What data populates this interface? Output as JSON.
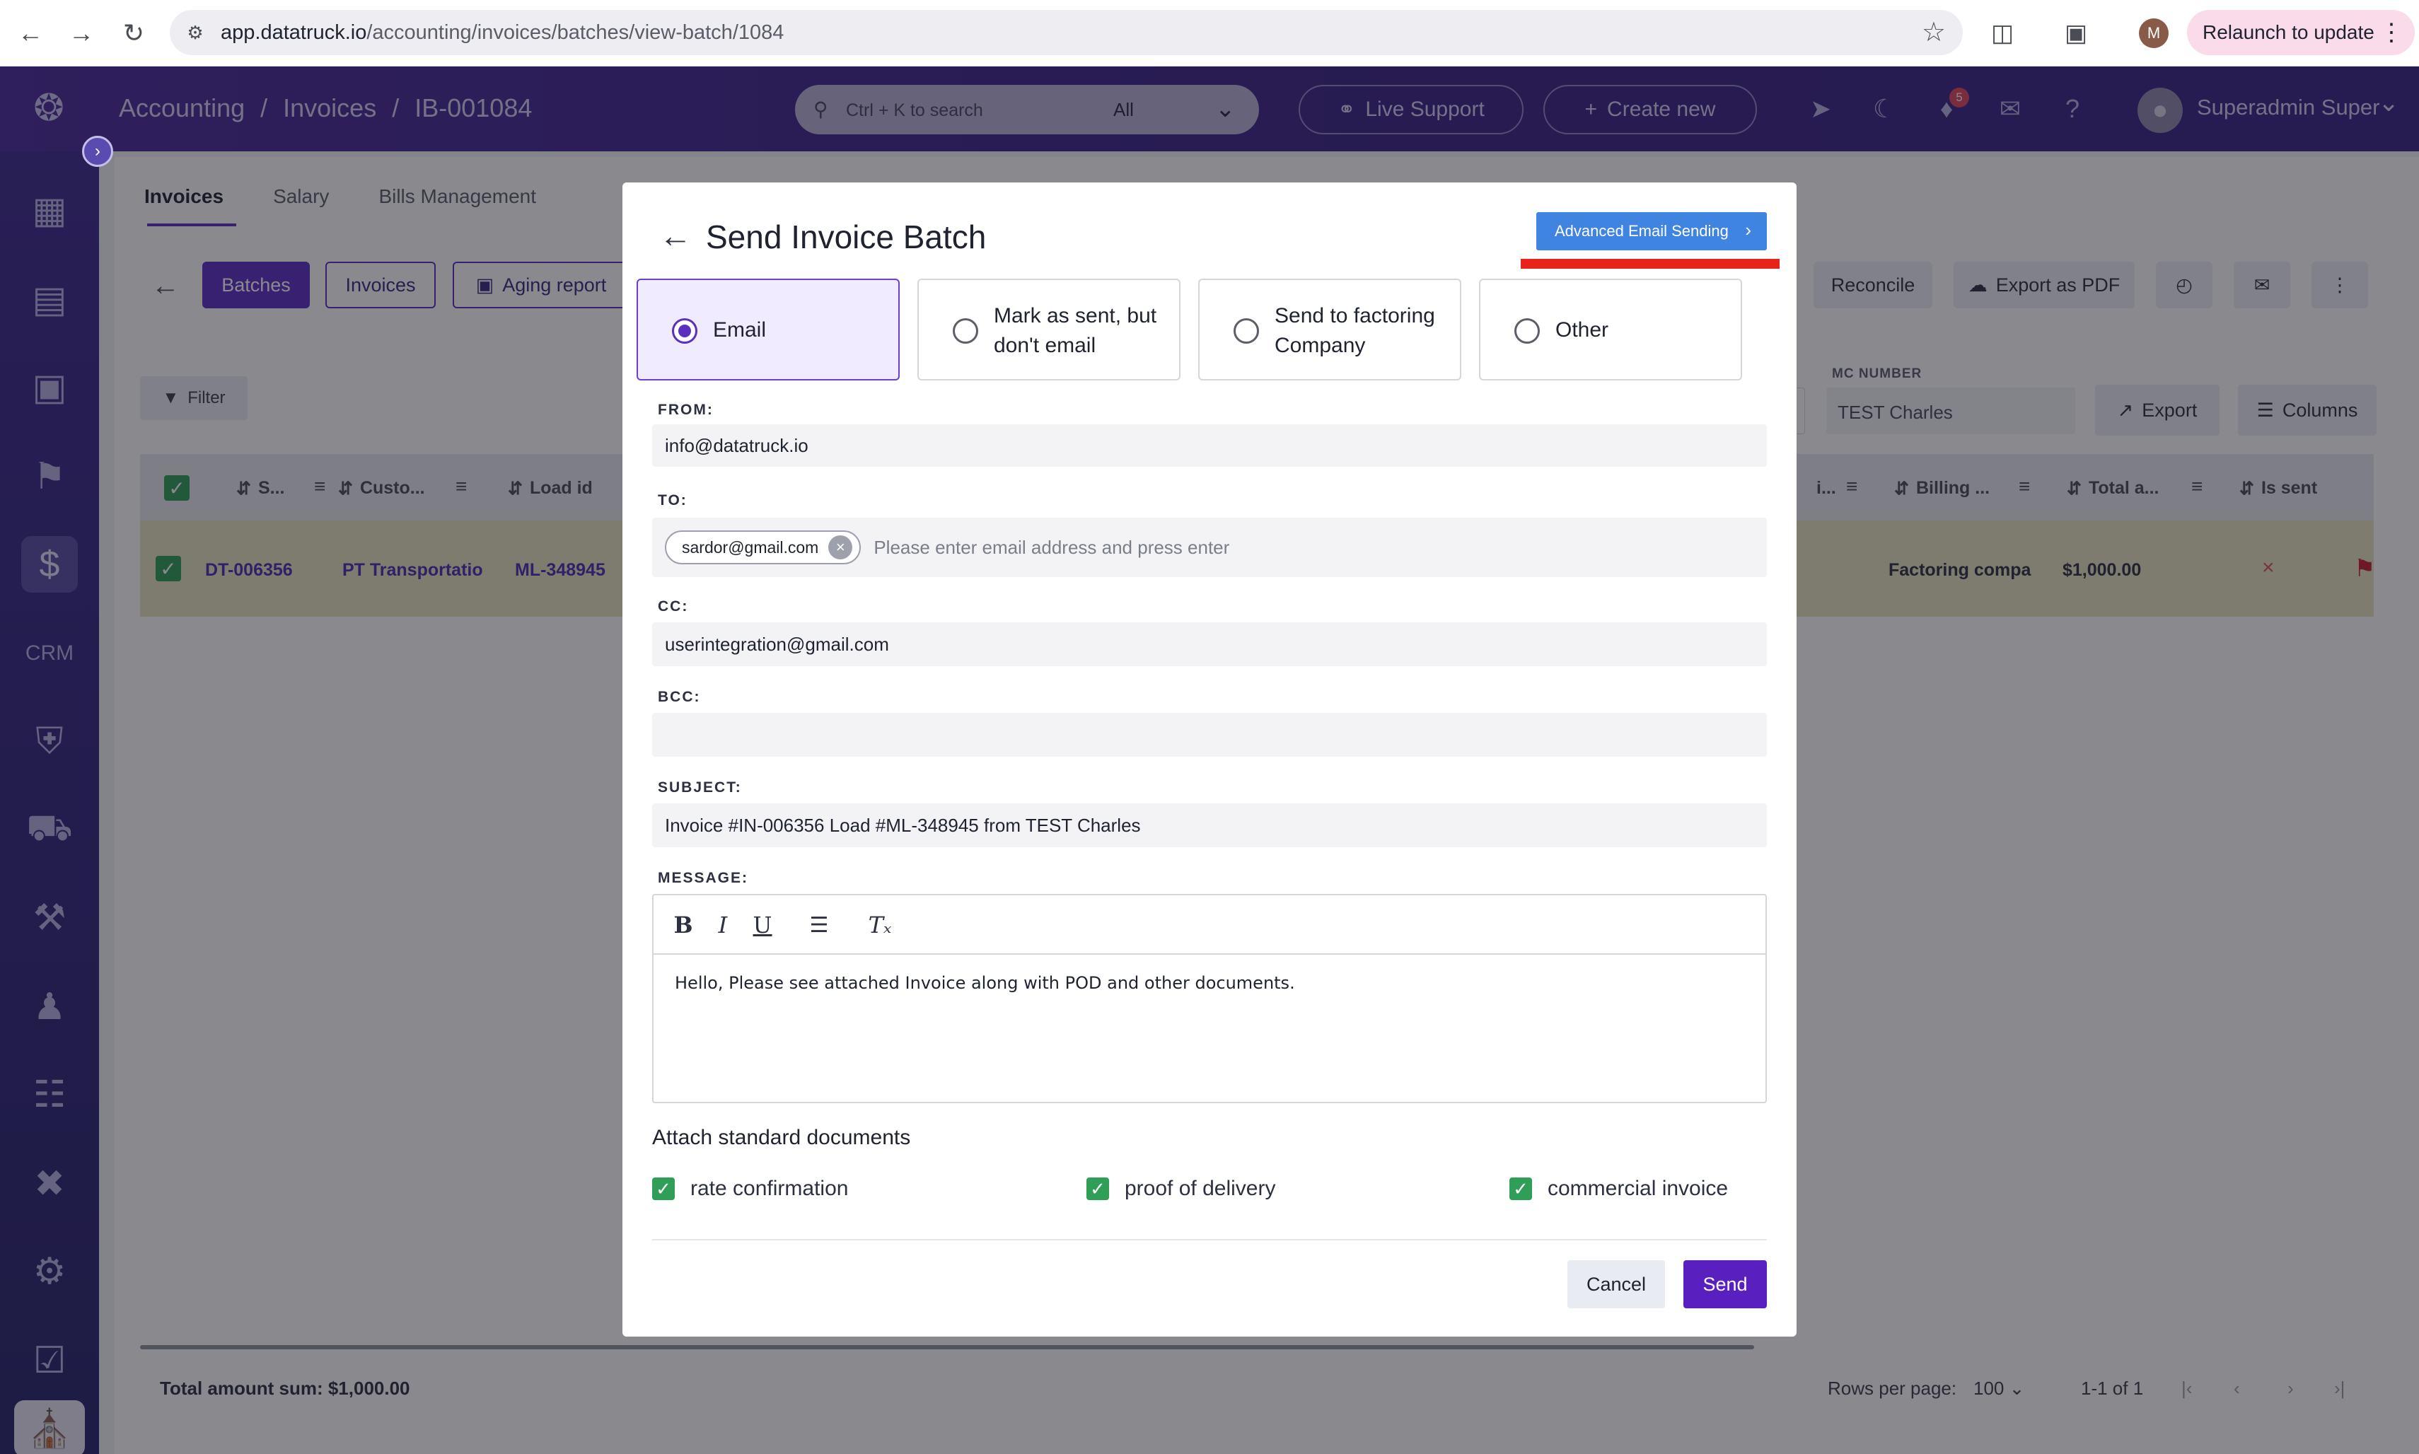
{
  "browser": {
    "url_domain": "app.datatruck.io",
    "url_path": "/accounting/invoices/batches/view-batch/1084",
    "profile_initial": "M",
    "relaunch_label": "Relaunch to update"
  },
  "header": {
    "breadcrumb": [
      "Accounting",
      "/",
      "Invoices",
      "/",
      "IB-001084"
    ],
    "search_placeholder": "Ctrl + K to search",
    "search_scope": "All",
    "live_support_label": "Live Support",
    "create_new_label": "Create new",
    "notification_count": "5",
    "user_name": "Superadmin Super"
  },
  "sidebar": {
    "items": [
      "dashboard-icon",
      "document-icon",
      "calendar-icon",
      "map-icon",
      "dollar-icon",
      "crm-icon",
      "shield-icon",
      "truck-icon",
      "tools-icon",
      "users-icon",
      "report-icon",
      "network-icon",
      "settings-icon",
      "checklist-icon",
      "building-icon"
    ],
    "active_item": "dollar-icon"
  },
  "page": {
    "tabs": [
      "Invoices",
      "Salary",
      "Bills Management"
    ],
    "active_tab": "Invoices",
    "toolbar": {
      "batches": "Batches",
      "invoices": "Invoices",
      "aging_report": "Aging report",
      "reconcile": "Reconcile",
      "export_pdf": "Export as PDF"
    },
    "filter_label": "Filter",
    "mc_number_label": "MC NUMBER",
    "mc_number_value": "TEST Charles",
    "export_label": "Export",
    "columns_label": "Columns",
    "table": {
      "headers_left": [
        "S...",
        "Custo...",
        "Load id"
      ],
      "headers_right": [
        "i...",
        "Billing ...",
        "Total a...",
        "Is sent"
      ],
      "row": {
        "invoice": "DT-006356",
        "customer": "PT Transportatio",
        "load_id": "ML-348945",
        "billing": "Factoring compa",
        "total": "$1,000.00",
        "is_sent": "×"
      }
    },
    "total_sum": "Total amount sum: $1,000.00",
    "rows_per_page_label": "Rows per page:",
    "rows_per_page_value": "100",
    "range": "1-1 of 1"
  },
  "modal": {
    "title": "Send Invoice Batch",
    "advanced_button": "Advanced Email Sending",
    "options": [
      {
        "label": "Email",
        "selected": true
      },
      {
        "label": "Mark as sent, but don't email",
        "selected": false
      },
      {
        "label": "Send to factoring Company",
        "selected": false
      },
      {
        "label": "Other",
        "selected": false
      }
    ],
    "from_label": "FROM:",
    "from_value": "info@datatruck.io",
    "to_label": "TO:",
    "to_chip": "sardor@gmail.com",
    "to_placeholder": "Please enter email address and press enter",
    "cc_label": "CC:",
    "cc_value": "userintegration@gmail.com",
    "bcc_label": "BCC:",
    "bcc_value": "",
    "subject_label": "SUBJECT:",
    "subject_value": "Invoice #IN-006356 Load #ML-348945 from TEST Charles",
    "message_label": "MESSAGE:",
    "message_value": "Hello, Please see attached Invoice along with POD and other documents.",
    "attach_title": "Attach standard documents",
    "attachments": [
      {
        "label": "rate confirmation",
        "checked": true
      },
      {
        "label": "proof of delivery",
        "checked": true
      },
      {
        "label": "commercial invoice",
        "checked": true
      }
    ],
    "cancel_label": "Cancel",
    "send_label": "Send"
  },
  "colors": {
    "brand_purple": "#5a1fbf",
    "header_gradient_start": "#4a2a9a",
    "advanced_button": "#3f84e0",
    "annotation_red": "#e8231c",
    "checkbox_green": "#2f9e56",
    "selected_row": "#e8e3c0"
  }
}
